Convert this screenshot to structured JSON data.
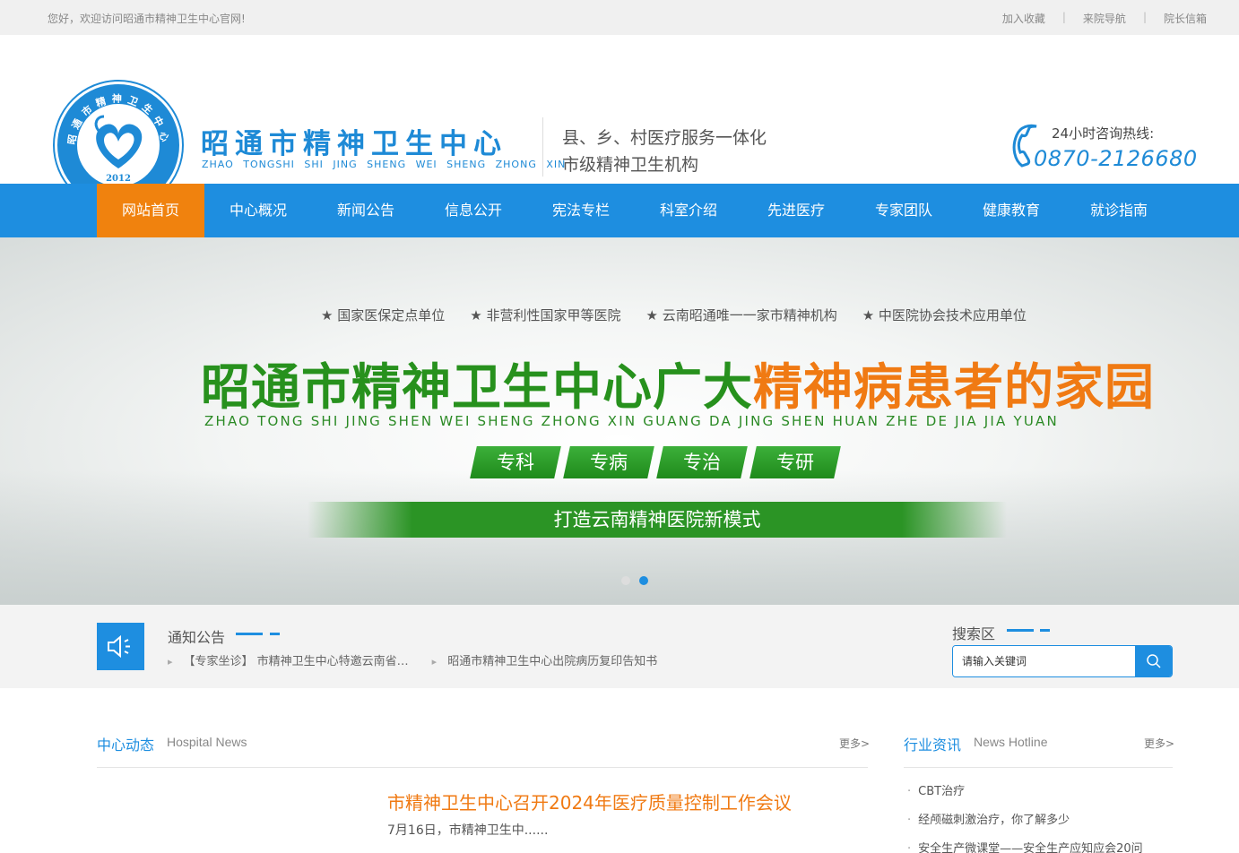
{
  "topbar": {
    "welcome": "您好，欢迎访问昭通市精神卫生中心官网!",
    "links": [
      "加入收藏",
      "来院导航",
      "院长信箱"
    ],
    "separator": "|"
  },
  "header": {
    "logo_year": "2012",
    "logo_ring_text": "昭通市精神卫生中心",
    "brand_cn": "昭通市精神卫生中心",
    "brand_en": "ZHAO TONGSHI SHI JING SHENG WEI SHENG ZHONG XIN",
    "slogan_line1": "县、乡、村医疗服务一体化",
    "slogan_line2": "市级精神卫生机构",
    "hotline_label": "24小时咨询热线:",
    "hotline_number": "0870-2126680"
  },
  "nav": {
    "items": [
      "网站首页",
      "中心概况",
      "新闻公告",
      "信息公开",
      "宪法专栏",
      "科室介绍",
      "先进医疗",
      "专家团队",
      "健康教育",
      "就诊指南"
    ],
    "active_index": 0
  },
  "banner": {
    "features": [
      "国家医保定点单位",
      "非营利性国家甲等医院",
      "云南昭通唯一一家市精神机构",
      "中医院协会技术应用单位"
    ],
    "title_green": "昭通市精神卫生中心广大",
    "title_orange": "精神病患者的家园",
    "pinyin": "ZHAO TONG SHI JING SHEN WEI SHENG ZHONG XIN GUANG DA JING SHEN HUAN ZHE DE JIA JIA YUAN",
    "tags": [
      "专科",
      "专病",
      "专治",
      "专研"
    ],
    "strip_text": "打造云南精神医院新模式",
    "slide_count": 2,
    "active_slide": 1
  },
  "notice": {
    "title": "通知公告",
    "items": [
      "【专家坐诊】 市精神卫生中心特邀云南省…",
      "昭通市精神卫生中心出院病历复印告知书"
    ]
  },
  "search": {
    "title": "搜索区",
    "placeholder": "请输入关键词"
  },
  "news": {
    "title": "中心动态",
    "subtitle": "Hospital News",
    "more": "更多>",
    "headline": "市精神卫生中心召开2024年医疗质量控制工作会议",
    "summary": "7月16日，市精神卫生中......"
  },
  "industry": {
    "title": "行业资讯",
    "subtitle": "News Hotline",
    "more": "更多>",
    "items": [
      "CBT治疗",
      "经颅磁刺激治疗，你了解多少",
      "安全生产微课堂——安全生产应知应会20问"
    ]
  },
  "colors": {
    "primary_blue": "#1e8ee0",
    "nav_active_orange": "#f0820e",
    "banner_green": "#27911d",
    "headline_orange": "#f07a13"
  },
  "icons": {
    "hotline": "phone-icon",
    "notice": "speaker-icon",
    "search": "search-icon"
  }
}
